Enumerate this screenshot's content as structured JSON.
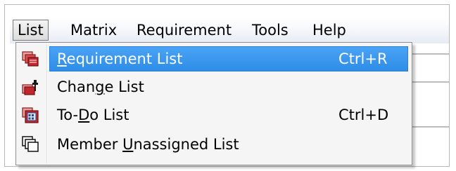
{
  "menubar": {
    "items": [
      {
        "label": "List",
        "open": true
      },
      {
        "label": "Matrix"
      },
      {
        "label": "Requirement"
      },
      {
        "label": "Tools"
      },
      {
        "label": "Help"
      }
    ]
  },
  "dropdown": {
    "items": [
      {
        "pre": "",
        "accel": "R",
        "post": "equirement List",
        "shortcut": "Ctrl+R",
        "icon": "requirement-list-icon",
        "highlighted": true
      },
      {
        "pre": "Chan",
        "accel": "g",
        "post": "e List",
        "shortcut": "",
        "icon": "change-list-icon"
      },
      {
        "pre": "To-",
        "accel": "D",
        "post": "o List",
        "shortcut": "Ctrl+D",
        "icon": "todo-list-icon"
      },
      {
        "pre": "Member ",
        "accel": "U",
        "post": "nassigned List",
        "shortcut": "",
        "icon": "member-unassigned-list-icon"
      }
    ]
  },
  "colors": {
    "highlight": "#3399ff",
    "menu_background": "#f5f5f5",
    "icon_red": "#c0282d"
  }
}
